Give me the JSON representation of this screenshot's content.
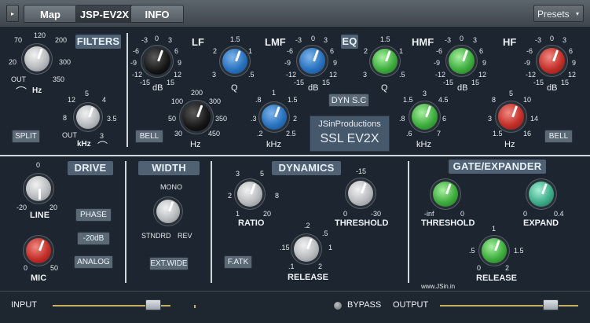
{
  "tabs": {
    "map": "Map",
    "plugin": "JSP-EV2X",
    "info": "INFO",
    "presets": "Presets"
  },
  "brand": {
    "company": "JSinProductions",
    "product": "SSL EV2X",
    "website": "www.JSin.in"
  },
  "filters": {
    "title": "FILTERS",
    "hp": {
      "ticks": [
        "70",
        "120",
        "200",
        "20",
        "300",
        "OUT",
        "350"
      ],
      "unit": "Hz"
    },
    "lp": {
      "ticks": [
        "5",
        "12",
        "4",
        "8",
        "3.5",
        "OUT",
        "3"
      ],
      "unit": "kHz"
    },
    "split": "SPLIT"
  },
  "eq": {
    "title": "EQ",
    "dyn_sc": "DYN S.C",
    "bell_left": "BELL",
    "bell_right": "BELL",
    "bands": {
      "lf": "LF",
      "lmf": "LMF",
      "hmf": "HMF",
      "hf": "HF"
    },
    "gain_ticks": [
      "-3",
      "0",
      "3",
      "-6",
      "6",
      "-9",
      "9",
      "-12",
      "12",
      "-15",
      "15"
    ],
    "gain_unit": "dB",
    "q_unit": "Q",
    "lmf_q_ticks": [
      "1.5",
      "2",
      "1",
      "3",
      ".5"
    ],
    "hmf_q_ticks": [
      "1.5",
      "2",
      "1",
      "3",
      ".5"
    ],
    "lf_freq": {
      "ticks": [
        "100",
        "200",
        "300",
        "50",
        "350",
        "30",
        "450"
      ],
      "unit": "Hz"
    },
    "lmf_freq": {
      "ticks": [
        "1",
        "1.5",
        ".8",
        ".3",
        "2",
        ".2",
        "2.5"
      ],
      "unit": "kHz"
    },
    "hmf_freq": {
      "ticks": [
        "3",
        "4.5",
        "1.5",
        "6",
        ".8",
        ".6",
        "7"
      ],
      "unit": "kHz"
    },
    "hf_freq": {
      "ticks": [
        "5",
        "8",
        "10",
        "3",
        "14",
        "1.5",
        "16"
      ],
      "unit": "Hz"
    }
  },
  "drive": {
    "title": "DRIVE",
    "line": {
      "ticks": [
        "0",
        "-20",
        "20"
      ],
      "label": "LINE"
    },
    "mic": {
      "ticks": [
        "0",
        "50"
      ],
      "label": "MIC"
    },
    "phase": "PHASE",
    "pad": "-20dB",
    "analog": "ANALOG"
  },
  "width": {
    "title": "WIDTH",
    "ticks": {
      "top": "MONO",
      "left": "STNDRD",
      "right": "REV"
    },
    "ext": "EXT.WIDE"
  },
  "dynamics": {
    "title": "DYNAMICS",
    "ratio": {
      "ticks": [
        "3",
        "5",
        "2",
        "8",
        "1",
        "20"
      ],
      "label": "RATIO"
    },
    "threshold": {
      "ticks": [
        "-15",
        "0",
        "-30"
      ],
      "label": "THRESHOLD"
    },
    "release": {
      "ticks": [
        ".2",
        ".15",
        ".5",
        "1",
        ".1",
        "2"
      ],
      "label": "RELEASE"
    },
    "fatk": "F.ATK"
  },
  "gate": {
    "title": "GATE/EXPANDER",
    "threshold": {
      "ticks": [
        "-inf",
        "0"
      ],
      "label": "THRESHOLD"
    },
    "expand": {
      "ticks": [
        "0",
        "0.4"
      ],
      "label": "EXPAND"
    },
    "release": {
      "ticks": [
        "1",
        ".5",
        "1.5",
        "0",
        "2"
      ],
      "label": "RELEASE"
    }
  },
  "footer": {
    "input": "INPUT",
    "bypass": "BYPASS",
    "output": "OUTPUT",
    "input_level": 0.85,
    "output_level": 0.8
  }
}
